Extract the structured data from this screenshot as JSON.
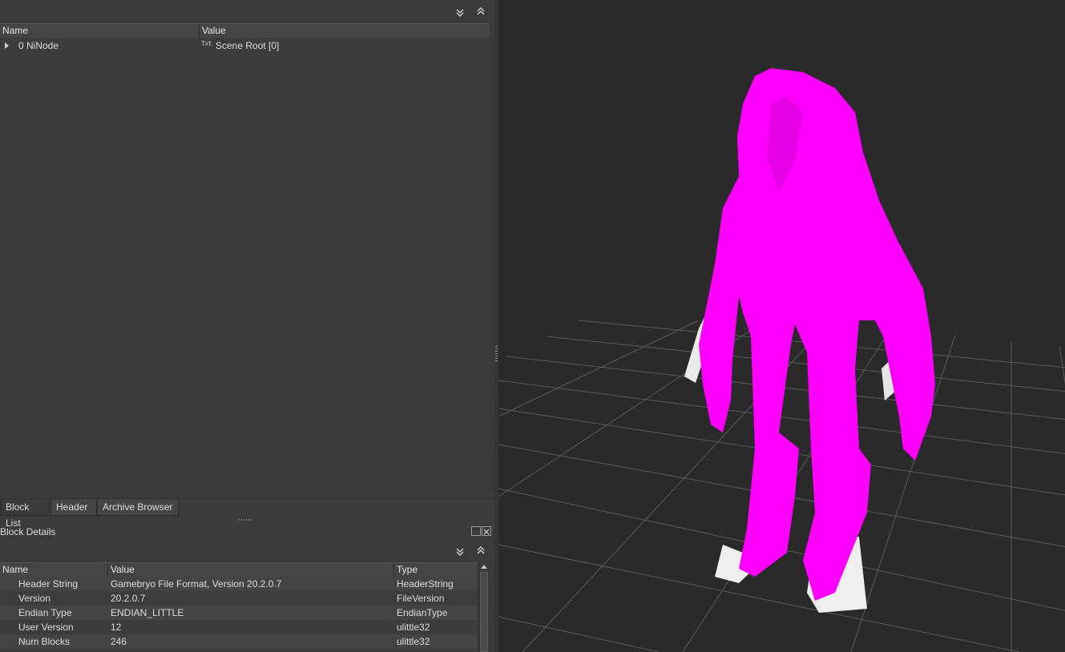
{
  "colors": {
    "model_primary": "#ff00ff",
    "model_secondary": "#f0f0f0",
    "viewport_bg": "#2a2a2a"
  },
  "block_list": {
    "toolbar": {
      "collapse_icon": "double-chevron-down-icon",
      "expand_icon": "double-chevron-up-icon"
    },
    "columns": {
      "name": "Name",
      "value": "Value"
    },
    "rows": [
      {
        "name": "0 NiNode",
        "value_icon": "Txt",
        "value": "Scene Root [0]"
      }
    ]
  },
  "tabs": [
    {
      "label": "Block List",
      "active": true
    },
    {
      "label": "Header",
      "active": false
    },
    {
      "label": "Archive Browser",
      "active": false
    }
  ],
  "block_details": {
    "title": "Block Details",
    "columns": {
      "name": "Name",
      "value": "Value",
      "type": "Type"
    },
    "rows": [
      {
        "name": "Header String",
        "value": "Gamebryo File Format, Version 20.2.0.7",
        "type": "HeaderString"
      },
      {
        "name": "Version",
        "value": "20.2.0.7",
        "type": "FileVersion"
      },
      {
        "name": "Endian Type",
        "value": "ENDIAN_LITTLE",
        "type": "EndianType"
      },
      {
        "name": "User Version",
        "value": "12",
        "type": "ulittle32"
      },
      {
        "name": "Num Blocks",
        "value": "246",
        "type": "ulittle32"
      }
    ]
  }
}
